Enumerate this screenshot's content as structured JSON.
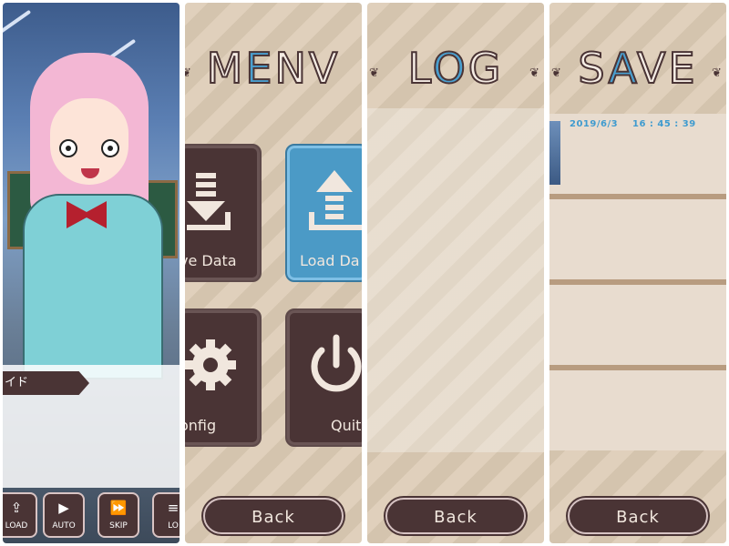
{
  "scene": {
    "speaker": "イド",
    "controls": [
      {
        "label": "LOAD",
        "icon": "load-icon"
      },
      {
        "label": "AUTO",
        "icon": "play-icon"
      },
      {
        "label": "SKIP",
        "icon": "fast-forward-icon"
      },
      {
        "label": "LO",
        "icon": "log-icon"
      }
    ]
  },
  "menu": {
    "title_pre": "M",
    "title_accent": "E",
    "title_post": "NV",
    "tiles": [
      {
        "label": "ve Data",
        "icon": "download-icon"
      },
      {
        "label": "Load Da",
        "icon": "upload-icon"
      },
      {
        "label": "onfig",
        "icon": "gear-icon"
      },
      {
        "label": "Quit",
        "icon": "power-icon"
      }
    ],
    "back_label": "Back"
  },
  "log": {
    "title_pre": "L",
    "title_accent": "O",
    "title_post": "G",
    "back_label": "Back"
  },
  "save": {
    "title_pre": "S",
    "title_accent": "A",
    "title_post": "VE",
    "slots": [
      {
        "date": "2019/6/3",
        "time": "16 : 45 : 39"
      },
      {
        "date": "",
        "time": ""
      },
      {
        "date": "",
        "time": ""
      },
      {
        "date": "",
        "time": ""
      }
    ],
    "back_label": "Back"
  },
  "colors": {
    "dark_brown": "#4a3435",
    "accent_blue": "#4a9fcf",
    "paper": "#dccbb4"
  }
}
